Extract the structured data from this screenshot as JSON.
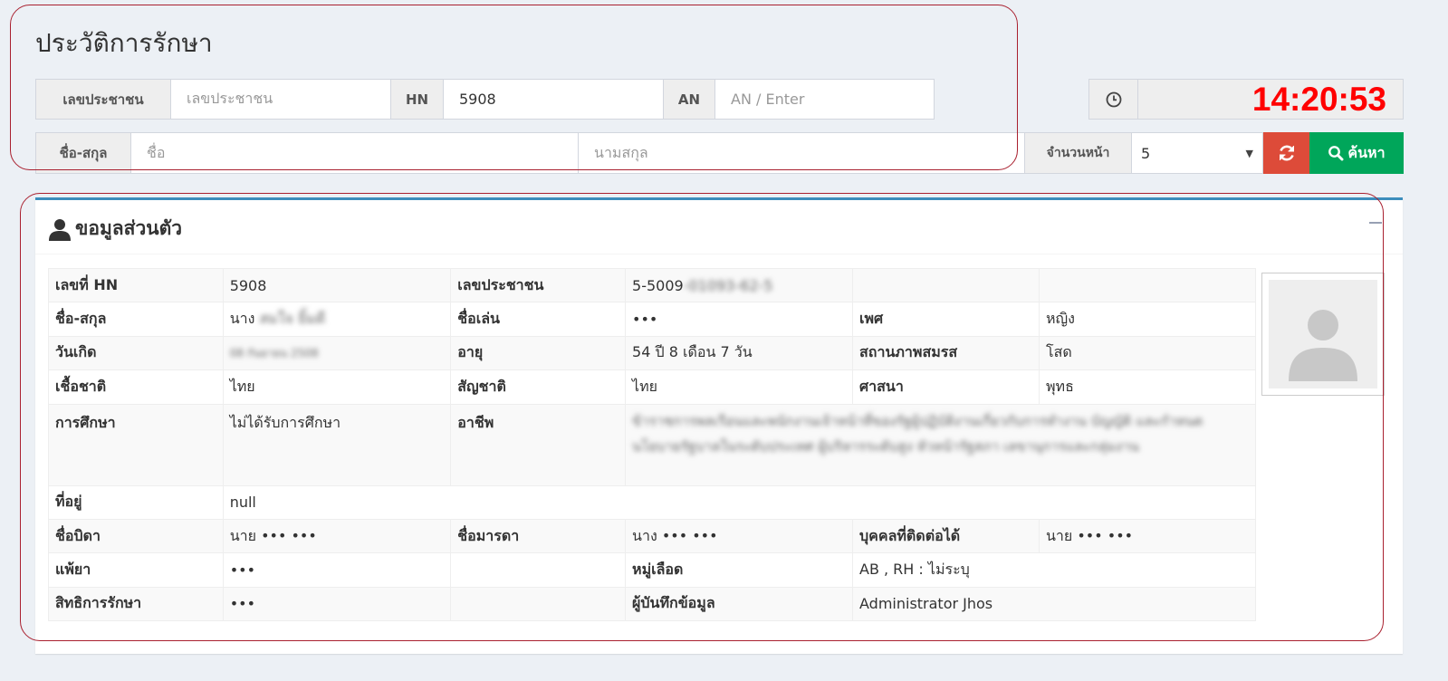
{
  "header": {
    "title": "ประวัติการรักษา"
  },
  "search": {
    "cid_label": "เลขประชาชน",
    "cid_placeholder": "เลขประชาชน",
    "hn_label": "HN",
    "hn_value": "5908",
    "an_label": "AN",
    "an_placeholder": "AN / Enter",
    "name_label": "ชื่อ-สกุล",
    "fname_placeholder": "ชื่อ",
    "lname_placeholder": "นามสกุล",
    "pages_label": "จำนวนหน้า",
    "pages_value": "5",
    "refresh_icon": "refresh-icon",
    "search_label": "ค้นหา",
    "search_icon": "search-icon"
  },
  "clock": {
    "time": "14:20:53",
    "icon": "clock-icon",
    "color": "#ff0000"
  },
  "profile": {
    "title": "ขอมูลส่วนตัว",
    "icon": "user-icon",
    "collapse_icon": "minus-icon",
    "accent": "#3c8dbc",
    "rows": {
      "hn_k": "เลขที่ HN",
      "hn_v": "5908",
      "cid_k": "เลขประชาชน",
      "cid_v": "5-5009",
      "cid_v_masked": "-01093-62-5",
      "name_k": "ชื่อ-สกุล",
      "name_prefix": "นาง",
      "name_masked": "สมใจ ยิ้มดี",
      "nick_k": "ชื่อเล่น",
      "nick_v": "•••",
      "sex_k": "เพศ",
      "sex_v": "หญิง",
      "dob_k": "วันเกิด",
      "dob_masked": "08 กันยายน 2508",
      "age_k": "อายุ",
      "age_v": "54 ปี 8 เดือน 7 วัน",
      "marital_k": "สถานภาพสมรส",
      "marital_v": "โสด",
      "race_k": "เชื้อชาติ",
      "race_v": "ไทย",
      "nation_k": "สัญชาติ",
      "nation_v": "ไทย",
      "religion_k": "ศาสนา",
      "religion_v": "พุทธ",
      "edu_k": "การศึกษา",
      "edu_v": "ไม่ได้รับการศึกษา",
      "occ_k": "อาชีพ",
      "occ_masked": "ข้าราชการพลเรือนและพนักงานเจ้าหน้าที่ของรัฐผู้ปฏิบัติงานเกี่ยวกับการทำงาน บัญญัติ และกำหนดนโยบายรัฐบาลในระดับประเทศ ผู้บริหารระดับสูง หัวหน้ารัฐสภา เลขานุการและกลุ่มงาน",
      "addr_k": "ที่อยู่",
      "addr_v": "null",
      "father_k": "ชื่อบิดา",
      "father_v": "นาย ••• •••",
      "mother_k": "ชื่อมารดา",
      "mother_v": "นาง ••• •••",
      "contact_k": "บุคคลที่ติดต่อได้",
      "contact_v": "นาย ••• •••",
      "allergy_k": "แพ้ยา",
      "allergy_v": "•••",
      "blood_k": "หมู่เลือด",
      "blood_v": "AB , RH : ไม่ระบุ",
      "right_k": "สิทธิการรักษา",
      "right_v": "•••",
      "recorder_k": "ผู้บันทึกข้อมูล",
      "recorder_v": "Administrator Jhos"
    },
    "photo_icon": "avatar-placeholder-icon"
  }
}
